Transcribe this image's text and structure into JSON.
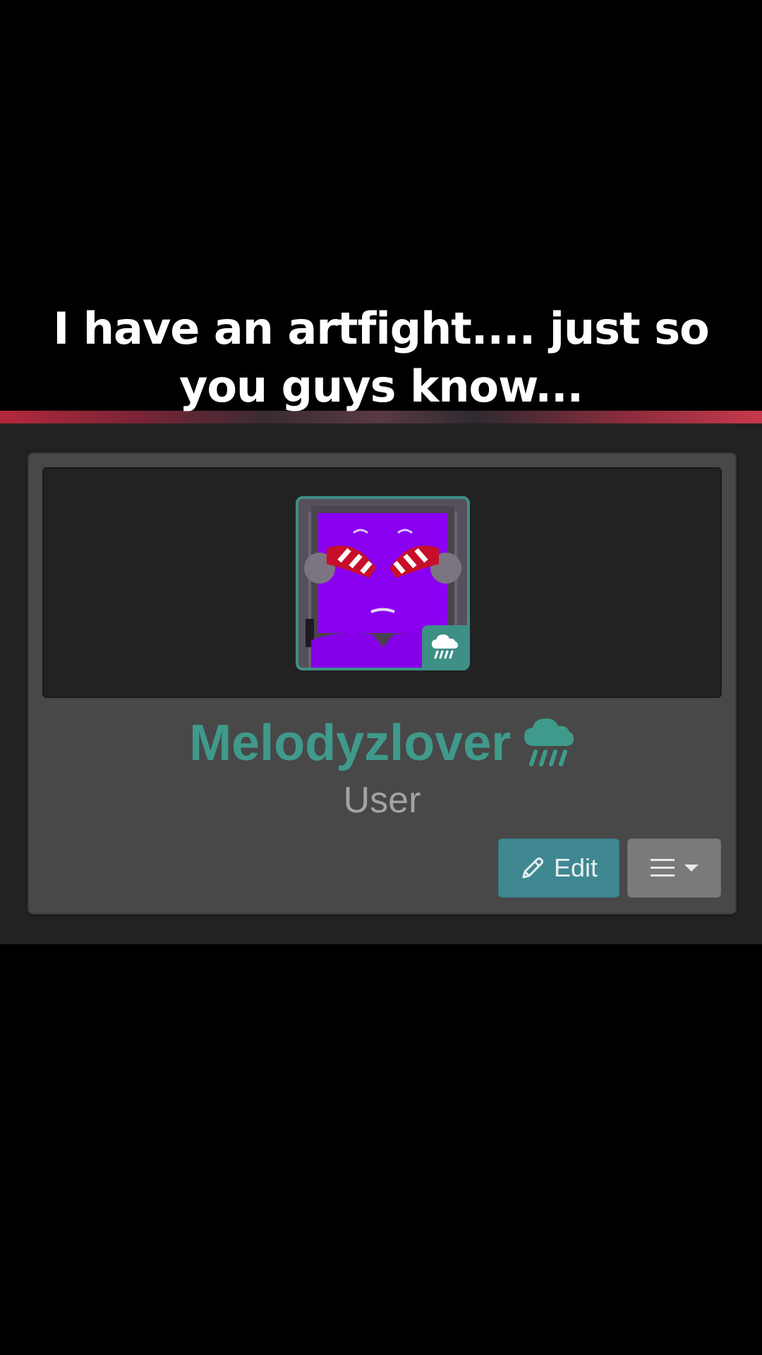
{
  "caption": {
    "line1": "I have an artfight.... just so",
    "line2": "you guys know..."
  },
  "profile": {
    "username": "Melodyzlover",
    "role": "User",
    "status_icon": "rain-cloud-icon",
    "avatar_badge_icon": "rain-cloud-icon"
  },
  "actions": {
    "edit_label": "Edit",
    "edit_icon": "pencil-icon",
    "menu_icon": "hamburger-menu-icon",
    "menu_caret_icon": "caret-down-icon"
  },
  "colors": {
    "accent_teal": "#3f9a8c",
    "edit_button": "#3f8891",
    "menu_button": "#7a7a7a",
    "card_bg": "#484848",
    "page_bg": "#222222"
  }
}
